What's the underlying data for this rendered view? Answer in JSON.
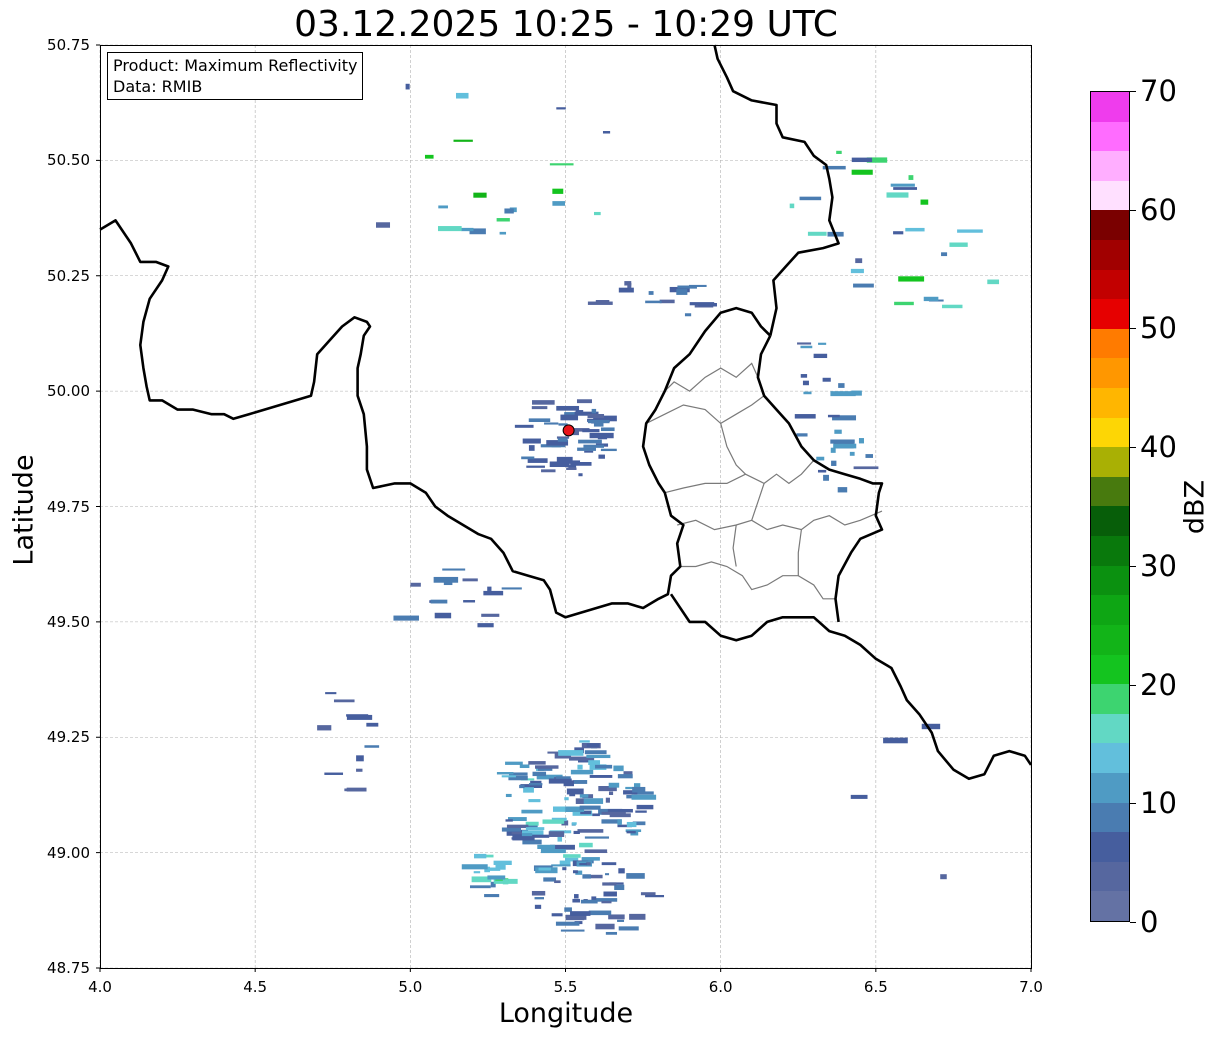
{
  "title": "03.12.2025 10:25 - 10:29 UTC",
  "axes": {
    "xlabel": "Longitude",
    "ylabel": "Latitude",
    "xlim": [
      4.0,
      7.0
    ],
    "ylim": [
      48.75,
      50.75
    ],
    "xticks": [
      "4.0",
      "4.5",
      "5.0",
      "5.5",
      "6.0",
      "6.5",
      "7.0"
    ],
    "yticks": [
      "48.75",
      "49.00",
      "49.25",
      "49.50",
      "49.75",
      "50.00",
      "50.25",
      "50.50",
      "50.75"
    ],
    "grid": true
  },
  "info": {
    "product": "Product: Maximum Reflectivity",
    "data": "Data: RMIB"
  },
  "radar_site": {
    "lon": 5.51,
    "lat": 49.915,
    "color": "#e8141a"
  },
  "colorbar": {
    "label": "dBZ",
    "ticks": [
      "0",
      "10",
      "20",
      "30",
      "40",
      "50",
      "60",
      "70"
    ],
    "range": [
      0,
      70
    ],
    "colors": [
      "#6472a4",
      "#56679f",
      "#465e9e",
      "#4a7cb1",
      "#4f9bc4",
      "#62bfdc",
      "#62d8c4",
      "#3dd470",
      "#14c41f",
      "#12b418",
      "#0ea614",
      "#0b9110",
      "#09790c",
      "#075e09",
      "#487a0e",
      "#a9b004",
      "#fdd605",
      "#ffb600",
      "#ff9700",
      "#ff7b00",
      "#e60000",
      "#c20000",
      "#a10000",
      "#7a0000",
      "#ffe0ff",
      "#ffaeff",
      "#ff6cff",
      "#ef3ced"
    ]
  },
  "chart_data": {
    "type": "map",
    "title": "03.12.2025 10:25 - 10:29 UTC",
    "xlabel": "Longitude",
    "ylabel": "Latitude",
    "xlim": [
      4.0,
      7.0
    ],
    "ylim": [
      48.75,
      50.75
    ],
    "borders_thick": [
      [
        [
          4.0,
          50.35
        ],
        [
          4.05,
          50.37
        ],
        [
          4.1,
          50.32
        ],
        [
          4.13,
          50.28
        ],
        [
          4.18,
          50.28
        ],
        [
          4.22,
          50.27
        ],
        [
          4.2,
          50.24
        ],
        [
          4.16,
          50.2
        ],
        [
          4.14,
          50.15
        ],
        [
          4.13,
          50.1
        ],
        [
          4.14,
          50.05
        ],
        [
          4.15,
          50.01
        ],
        [
          4.16,
          49.98
        ],
        [
          4.2,
          49.98
        ],
        [
          4.25,
          49.96
        ],
        [
          4.3,
          49.96
        ],
        [
          4.36,
          49.95
        ],
        [
          4.4,
          49.95
        ],
        [
          4.43,
          49.94
        ],
        [
          4.48,
          49.95
        ],
        [
          4.53,
          49.96
        ],
        [
          4.58,
          49.97
        ],
        [
          4.63,
          49.98
        ],
        [
          4.68,
          49.99
        ],
        [
          4.69,
          50.02
        ],
        [
          4.7,
          50.08
        ],
        [
          4.74,
          50.11
        ],
        [
          4.78,
          50.14
        ],
        [
          4.82,
          50.16
        ],
        [
          4.86,
          50.15
        ],
        [
          4.87,
          50.14
        ],
        [
          4.85,
          50.12
        ],
        [
          4.84,
          50.08
        ],
        [
          4.83,
          50.05
        ],
        [
          4.83,
          49.99
        ],
        [
          4.85,
          49.95
        ],
        [
          4.86,
          49.88
        ],
        [
          4.86,
          49.83
        ],
        [
          4.88,
          49.79
        ],
        [
          4.95,
          49.8
        ],
        [
          5.0,
          49.8
        ],
        [
          5.05,
          49.78
        ],
        [
          5.08,
          49.75
        ],
        [
          5.12,
          49.73
        ],
        [
          5.17,
          49.71
        ],
        [
          5.22,
          49.69
        ],
        [
          5.26,
          49.68
        ],
        [
          5.3,
          49.65
        ],
        [
          5.33,
          49.61
        ],
        [
          5.38,
          49.6
        ],
        [
          5.43,
          49.59
        ],
        [
          5.45,
          49.57
        ],
        [
          5.47,
          49.52
        ],
        [
          5.5,
          49.51
        ],
        [
          5.55,
          49.52
        ],
        [
          5.6,
          49.53
        ],
        [
          5.65,
          49.54
        ],
        [
          5.7,
          49.54
        ],
        [
          5.75,
          49.53
        ],
        [
          5.8,
          49.55
        ],
        [
          5.83,
          49.56
        ],
        [
          5.84,
          49.6
        ],
        [
          5.87,
          49.62
        ],
        [
          5.86,
          49.67
        ],
        [
          5.88,
          49.71
        ],
        [
          5.84,
          49.73
        ],
        [
          5.82,
          49.78
        ],
        [
          5.8,
          49.8
        ],
        [
          5.77,
          49.84
        ],
        [
          5.75,
          49.88
        ],
        [
          5.76,
          49.93
        ],
        [
          5.79,
          49.96
        ],
        [
          5.82,
          50.0
        ],
        [
          5.85,
          50.05
        ],
        [
          5.9,
          50.08
        ],
        [
          5.95,
          50.13
        ],
        [
          6.0,
          50.17
        ],
        [
          6.05,
          50.18
        ],
        [
          6.1,
          50.17
        ],
        [
          6.13,
          50.14
        ],
        [
          6.16,
          50.12
        ]
      ],
      [
        [
          5.84,
          49.56
        ],
        [
          5.9,
          49.5
        ],
        [
          5.95,
          49.5
        ],
        [
          6.0,
          49.47
        ],
        [
          6.05,
          49.46
        ],
        [
          6.1,
          49.47
        ],
        [
          6.15,
          49.5
        ],
        [
          6.2,
          49.51
        ],
        [
          6.25,
          49.51
        ],
        [
          6.3,
          49.51
        ],
        [
          6.35,
          49.48
        ],
        [
          6.4,
          49.47
        ],
        [
          6.45,
          49.45
        ],
        [
          6.5,
          49.42
        ],
        [
          6.55,
          49.4
        ],
        [
          6.58,
          49.36
        ],
        [
          6.6,
          49.33
        ],
        [
          6.64,
          49.3
        ],
        [
          6.68,
          49.26
        ],
        [
          6.7,
          49.22
        ],
        [
          6.75,
          49.18
        ],
        [
          6.8,
          49.16
        ],
        [
          6.85,
          49.17
        ],
        [
          6.88,
          49.21
        ],
        [
          6.93,
          49.22
        ],
        [
          6.98,
          49.21
        ],
        [
          7.0,
          49.19
        ]
      ],
      [
        [
          6.16,
          50.12
        ],
        [
          6.13,
          50.08
        ],
        [
          6.12,
          50.03
        ],
        [
          6.14,
          49.99
        ],
        [
          6.18,
          49.96
        ],
        [
          6.22,
          49.93
        ],
        [
          6.26,
          49.88
        ],
        [
          6.3,
          49.85
        ],
        [
          6.35,
          49.83
        ],
        [
          6.4,
          49.82
        ],
        [
          6.45,
          49.81
        ],
        [
          6.49,
          49.8
        ],
        [
          6.52,
          49.8
        ],
        [
          6.51,
          49.78
        ],
        [
          6.5,
          49.73
        ],
        [
          6.52,
          49.7
        ],
        [
          6.45,
          49.68
        ],
        [
          6.42,
          49.65
        ],
        [
          6.38,
          49.6
        ],
        [
          6.37,
          49.55
        ],
        [
          6.38,
          49.5
        ]
      ],
      [
        [
          6.16,
          50.12
        ],
        [
          6.18,
          50.18
        ],
        [
          6.17,
          50.24
        ],
        [
          6.21,
          50.27
        ],
        [
          6.25,
          50.3
        ],
        [
          6.33,
          50.31
        ],
        [
          6.38,
          50.32
        ],
        [
          6.35,
          50.37
        ],
        [
          6.36,
          50.42
        ],
        [
          6.35,
          50.46
        ],
        [
          6.34,
          50.49
        ],
        [
          6.3,
          50.51
        ],
        [
          6.27,
          50.54
        ],
        [
          6.2,
          50.55
        ],
        [
          6.18,
          50.58
        ],
        [
          6.18,
          50.62
        ],
        [
          6.1,
          50.63
        ],
        [
          6.04,
          50.65
        ],
        [
          6.02,
          50.68
        ],
        [
          5.99,
          50.72
        ],
        [
          5.98,
          50.75
        ]
      ]
    ],
    "borders_thin": [
      [
        [
          5.87,
          49.62
        ],
        [
          5.92,
          49.62
        ],
        [
          5.97,
          49.63
        ],
        [
          6.02,
          49.62
        ],
        [
          6.07,
          49.6
        ],
        [
          6.1,
          49.57
        ],
        [
          6.15,
          49.58
        ],
        [
          6.2,
          49.6
        ],
        [
          6.25,
          49.6
        ],
        [
          6.3,
          49.58
        ],
        [
          6.33,
          49.55
        ],
        [
          6.37,
          49.55
        ]
      ],
      [
        [
          5.86,
          49.71
        ],
        [
          5.92,
          49.72
        ],
        [
          5.98,
          49.7
        ],
        [
          6.05,
          49.71
        ],
        [
          6.1,
          49.72
        ],
        [
          6.15,
          49.7
        ],
        [
          6.2,
          49.71
        ],
        [
          6.26,
          49.7
        ],
        [
          6.3,
          49.72
        ],
        [
          6.35,
          49.73
        ],
        [
          6.4,
          49.71
        ],
        [
          6.45,
          49.72
        ],
        [
          6.52,
          49.74
        ]
      ],
      [
        [
          5.82,
          49.78
        ],
        [
          5.88,
          49.79
        ],
        [
          5.95,
          49.8
        ],
        [
          6.02,
          49.8
        ],
        [
          6.08,
          49.82
        ],
        [
          6.14,
          49.8
        ],
        [
          6.18,
          49.82
        ],
        [
          6.22,
          49.8
        ],
        [
          6.26,
          49.82
        ],
        [
          6.3,
          49.85
        ]
      ],
      [
        [
          5.76,
          49.93
        ],
        [
          5.82,
          49.95
        ],
        [
          5.88,
          49.97
        ],
        [
          5.95,
          49.96
        ],
        [
          6.0,
          49.93
        ],
        [
          6.05,
          49.95
        ],
        [
          6.1,
          49.97
        ],
        [
          6.14,
          49.99
        ]
      ],
      [
        [
          5.82,
          50.0
        ],
        [
          5.85,
          50.02
        ],
        [
          5.9,
          50.0
        ],
        [
          5.95,
          50.03
        ],
        [
          6.0,
          50.05
        ],
        [
          6.05,
          50.03
        ],
        [
          6.1,
          50.06
        ],
        [
          6.12,
          50.03
        ]
      ],
      [
        [
          6.0,
          49.93
        ],
        [
          6.02,
          49.88
        ],
        [
          6.05,
          49.84
        ],
        [
          6.08,
          49.82
        ]
      ],
      [
        [
          6.1,
          49.72
        ],
        [
          6.12,
          49.76
        ],
        [
          6.14,
          49.8
        ]
      ],
      [
        [
          6.05,
          49.71
        ],
        [
          6.04,
          49.66
        ],
        [
          6.05,
          49.62
        ]
      ],
      [
        [
          6.26,
          49.7
        ],
        [
          6.25,
          49.65
        ],
        [
          6.25,
          49.6
        ]
      ]
    ],
    "precip_zones": [
      {
        "lon": 5.45,
        "lat": 49.07,
        "rx": 0.2,
        "ry": 0.1,
        "angle": -35,
        "count": 80,
        "dbz": [
          3,
          16
        ]
      },
      {
        "lon": 5.62,
        "lat": 49.15,
        "rx": 0.18,
        "ry": 0.07,
        "angle": -30,
        "count": 55,
        "dbz": [
          3,
          14
        ]
      },
      {
        "lon": 5.6,
        "lat": 48.9,
        "rx": 0.2,
        "ry": 0.08,
        "angle": 0,
        "count": 40,
        "dbz": [
          3,
          10
        ]
      },
      {
        "lon": 5.25,
        "lat": 48.95,
        "rx": 0.06,
        "ry": 0.05,
        "angle": 0,
        "count": 16,
        "dbz": [
          8,
          20
        ]
      },
      {
        "lon": 5.5,
        "lat": 49.9,
        "rx": 0.15,
        "ry": 0.09,
        "angle": 0,
        "count": 50,
        "dbz": [
          3,
          10
        ]
      },
      {
        "lon": 6.35,
        "lat": 49.95,
        "rx": 0.2,
        "ry": 0.1,
        "angle": -60,
        "count": 30,
        "dbz": [
          3,
          12
        ]
      },
      {
        "lon": 6.55,
        "lat": 50.35,
        "rx": 0.35,
        "ry": 0.15,
        "angle": -20,
        "count": 28,
        "dbz": [
          3,
          22
        ]
      },
      {
        "lon": 5.2,
        "lat": 50.45,
        "rx": 0.5,
        "ry": 0.25,
        "angle": 0,
        "count": 20,
        "dbz": [
          3,
          24
        ]
      },
      {
        "lon": 4.8,
        "lat": 49.25,
        "rx": 0.1,
        "ry": 0.12,
        "angle": 0,
        "count": 12,
        "dbz": [
          3,
          8
        ]
      },
      {
        "lon": 5.8,
        "lat": 50.2,
        "rx": 0.2,
        "ry": 0.04,
        "angle": 0,
        "count": 16,
        "dbz": [
          3,
          10
        ]
      },
      {
        "lon": 5.15,
        "lat": 49.55,
        "rx": 0.2,
        "ry": 0.08,
        "angle": 0,
        "count": 15,
        "dbz": [
          3,
          10
        ]
      },
      {
        "lon": 6.6,
        "lat": 49.1,
        "rx": 0.3,
        "ry": 0.2,
        "angle": 0,
        "count": 4,
        "dbz": [
          3,
          8
        ]
      }
    ]
  }
}
